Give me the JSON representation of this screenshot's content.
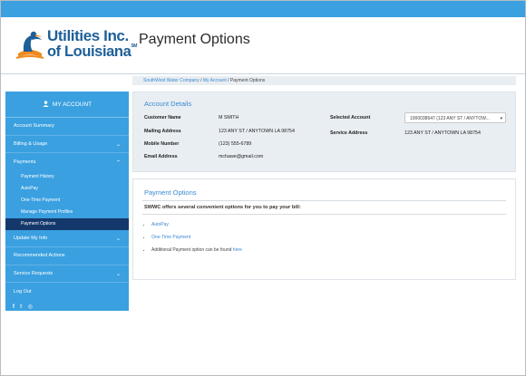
{
  "header": {
    "logo_line1": "Utilities Inc.",
    "logo_line2": "of Louisiana",
    "logo_sm": "SM",
    "page_title": "Payment Options"
  },
  "breadcrumb": {
    "company": "SouthWest Water Company",
    "account": "My Account",
    "current": "Payment Options",
    "separator": "/"
  },
  "sidebar": {
    "title": "MY ACCOUNT",
    "items": {
      "account_summary": "Account Summary",
      "billing_usage": "Billing & Usage",
      "payments": "Payments",
      "payment_history": "Payment History",
      "autopay": "AutoPay",
      "one_time_payment": "One-Time Payment",
      "manage_payment_profiles": "Manage Payment Profiles",
      "payment_options": "Payment Options",
      "update_my_info": "Update My Info",
      "recommended_actions": "Recommended Actions",
      "service_requests": "Service Requests",
      "log_out": "Log Out"
    },
    "social": [
      "f",
      "𝕥",
      "◎"
    ]
  },
  "account_details": {
    "title": "Account Details",
    "customer_name_label": "Customer Name",
    "customer_name": "M SMITH",
    "mailing_address_label": "Mailing Address",
    "mailing_address": "123 ANY ST / ANYTOWN LA 98754",
    "mobile_number_label": "Mobile Number",
    "mobile_number": "(123) 555-6789",
    "email_label": "Email Address",
    "email": "mchawe@gmail.com",
    "selected_account_label": "Selected Account",
    "selected_account": "1000038647 (123 ANY ST / ANYTOW...",
    "service_address_label": "Service Address",
    "service_address": "123 ANY ST / ANYTOWN LA 98754"
  },
  "payment_options": {
    "title": "Payment Options",
    "intro": "SWWC offers several convenient options for you to pay your bill:",
    "autopay": "AutoPay",
    "one_time_payment": "One-Time Payment",
    "additional_text": "Additional Payment option can be found",
    "here_link": "here"
  },
  "colors": {
    "brand_blue": "#3aa0e0",
    "active_item": "#14386b",
    "link_blue": "#3a8ad0",
    "panel_bg": "#e9eef3"
  }
}
